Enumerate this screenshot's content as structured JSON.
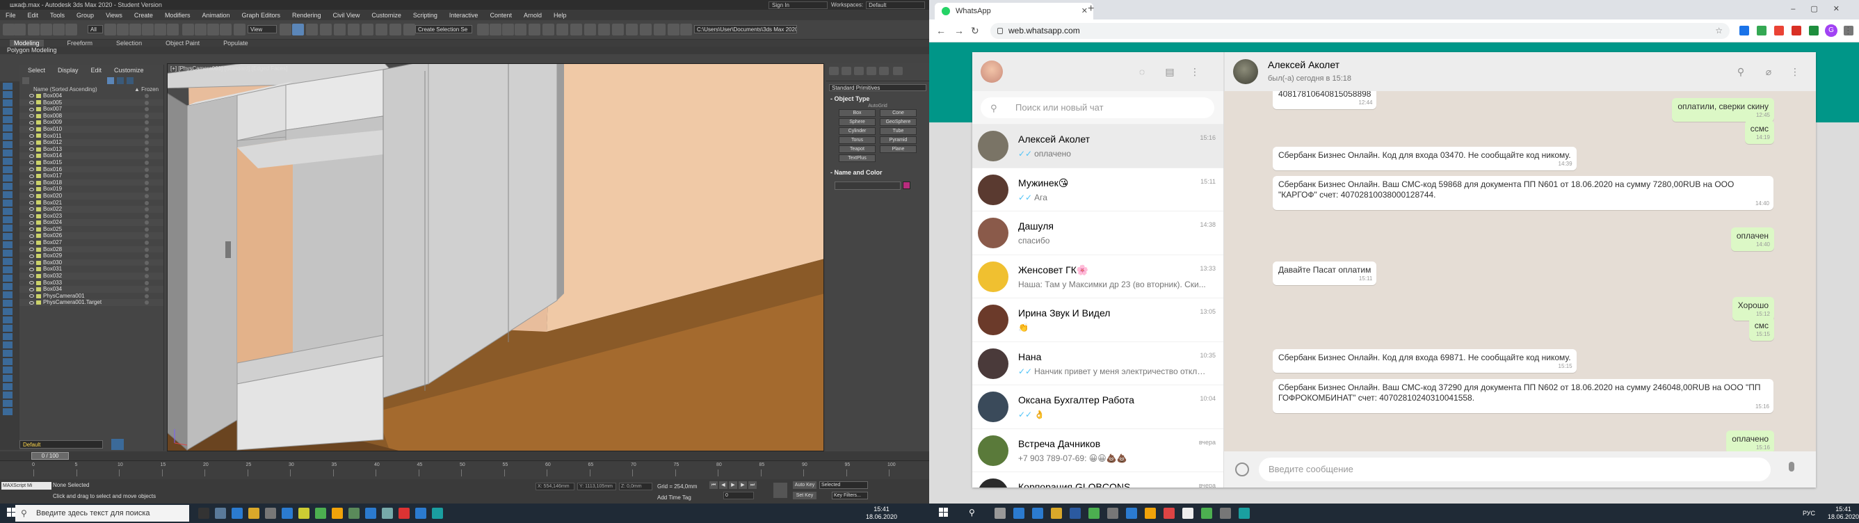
{
  "max": {
    "title": "шкаф.max - Autodesk 3ds Max 2020 - Student Version",
    "menu": [
      "File",
      "Edit",
      "Tools",
      "Group",
      "Views",
      "Create",
      "Modifiers",
      "Animation",
      "Graph Editors",
      "Rendering",
      "Civil View",
      "Customize",
      "Scripting",
      "Interactive",
      "Content",
      "Arnold",
      "Help"
    ],
    "signin": "Sign In",
    "workspaces_label": "Workspaces:",
    "workspaces_value": "Default",
    "toolbar_all": "All",
    "toolbar_view": "View",
    "toolbar_selset": "Create Selection Se",
    "toolbar_path": "C:\\Users\\User\\Documents\\3ds Max 2020",
    "ribbon_tabs": [
      "Modeling",
      "Freeform",
      "Selection",
      "Object Paint",
      "Populate"
    ],
    "polymod": "Polygon Modeling",
    "scene_tabs": [
      "Select",
      "Display",
      "Edit",
      "Customize"
    ],
    "scene_col_name": "Name (Sorted Ascending)",
    "scene_col_frozen": "▲ Frozen",
    "scene_items": [
      "Box004",
      "Box005",
      "Box007",
      "Box008",
      "Box009",
      "Box010",
      "Box011",
      "Box012",
      "Box013",
      "Box014",
      "Box015",
      "Box016",
      "Box017",
      "Box018",
      "Box019",
      "Box020",
      "Box021",
      "Box022",
      "Box023",
      "Box024",
      "Box025",
      "Box026",
      "Box027",
      "Box028",
      "Box029",
      "Box030",
      "Box031",
      "Box032",
      "Box033",
      "Box034",
      "PhysCamera001",
      "PhysCamera001.Target"
    ],
    "viewport_label": "[+] [PhysCamera001] [Standard] [Edged Faces]",
    "cmd_dropdown": "Standard Primitives",
    "rollout_object_type": "- Object Type",
    "autogrid": "AutoGrid",
    "objects": [
      "Box",
      "Cone",
      "Sphere",
      "GeoSphere",
      "Cylinder",
      "Tube",
      "Torus",
      "Pyramid",
      "Teapot",
      "Plane",
      "TextPlus"
    ],
    "rollout_name_color": "- Name and Color",
    "layer_default": "Default",
    "time_slider": "0 / 100",
    "ruler_ticks": [
      "0",
      "5",
      "10",
      "15",
      "20",
      "25",
      "30",
      "35",
      "40",
      "45",
      "50",
      "55",
      "60",
      "65",
      "70",
      "75",
      "80",
      "85",
      "90",
      "95",
      "100"
    ],
    "maxscript": "MAXScript Mi",
    "status_selected": "None Selected",
    "status_prompt": "Click and drag to select and move objects",
    "coord_x": "X: 554,146mm",
    "coord_y": "Y: 1113,105mm",
    "coord_z": "Z: 0,0mm",
    "grid_label": "Grid = 254,0mm",
    "add_time_tag": "Add Time Tag",
    "auto_key": "Auto Key",
    "set_key": "Set Key",
    "selected_dd": "Selected",
    "key_filters": "Key Filters...",
    "frame_value": "0"
  },
  "chrome": {
    "tab_title": "WhatsApp",
    "url": "web.whatsapp.com",
    "profile_letter": "G"
  },
  "whatsapp": {
    "search_placeholder": "Поиск или новый чат",
    "chats": [
      {
        "name": "Алексей Аколет",
        "time": "15:16",
        "preview": "оплачено",
        "tick": "✓✓",
        "avatar": "#7a7466"
      },
      {
        "name": "Мужинек😘",
        "time": "15:11",
        "preview": "Ага",
        "tick": "✓✓",
        "avatar": "#5a3a30"
      },
      {
        "name": "Дашуля",
        "time": "14:38",
        "preview": "спасибо",
        "tick": "",
        "avatar": "#8a5a4a"
      },
      {
        "name": "Женсовет ГК🌸",
        "time": "13:33",
        "preview": "Наша: Там у Максимки др 23 (во вторник). Ски...",
        "tick": "",
        "avatar": "#f0c030"
      },
      {
        "name": "Ирина Звук И Видел",
        "time": "13:05",
        "preview": "👏",
        "tick": "",
        "avatar": "#6b3a2a"
      },
      {
        "name": "Нана",
        "time": "10:35",
        "preview": "Нанчик привет у меня электричество отклю...",
        "tick": "✓✓",
        "avatar": "#4a3a3a"
      },
      {
        "name": "Оксана Бухгалтер Работа",
        "time": "10:04",
        "preview": "👌",
        "tick": "✓✓",
        "avatar": "#3a4a5a"
      },
      {
        "name": "Встреча Дачников",
        "time": "вчера",
        "preview": "+7 903 789-07-69: 😀😀💩💩",
        "tick": "",
        "avatar": "#5a7a3a"
      },
      {
        "name": "Корпорация GLOBCONS",
        "time": "вчера",
        "preview": "",
        "tick": "",
        "avatar": "#2a2a2a"
      }
    ],
    "contact_name": "Алексей Аколет",
    "contact_status": "был(-а) сегодня в 15:18",
    "messages": [
      {
        "dir": "in",
        "text": "40817810640815058898",
        "time": "12:44"
      },
      {
        "dir": "out",
        "text": "оплатили, сверки скину",
        "time": "12:45"
      },
      {
        "dir": "out",
        "text": "ссмс",
        "time": "14:19"
      },
      {
        "dir": "in",
        "text": "Сбербанк Бизнес Онлайн. Код для входа 03470. Не сообщайте код никому.",
        "time": "14:39"
      },
      {
        "dir": "in",
        "text": "Сбербанк Бизнес Онлайн. Ваш СМС-код 59868 для документа ПП N601 от 18.06.2020  на сумму 7280,00RUB на ООО \"КАРГОФ\" счет: 40702810038000128744.",
        "time": "14:40"
      },
      {
        "dir": "out",
        "text": "оплачен",
        "time": "14:40"
      },
      {
        "dir": "in",
        "text": "Давайте Пасат оплатим",
        "time": "15:11"
      },
      {
        "dir": "out",
        "text": "Хорошо",
        "time": "15:12"
      },
      {
        "dir": "out",
        "text": "смс",
        "time": "15:15"
      },
      {
        "dir": "in",
        "text": "Сбербанк Бизнес Онлайн. Код для входа 69871. Не сообщайте код никому.",
        "time": "15:15"
      },
      {
        "dir": "in",
        "text": "Сбербанк Бизнес Онлайн. Ваш СМС-код 37290 для документа ПП N602 от 18.06.2020  на сумму 246048,00RUB на ООО \"ПП ГОФРОКОМБИНАТ\" счет: 40702810240310041558.",
        "time": "15:16"
      },
      {
        "dir": "out",
        "text": "оплачено",
        "time": "15:16"
      }
    ],
    "composer_placeholder": "Введите сообщение"
  },
  "taskbar": {
    "search_placeholder": "Введите здесь текст для поиска",
    "left_time": "15:41",
    "left_date": "18.06.2020",
    "right_time": "15:41",
    "right_date": "18.06.2020",
    "lang": "РУС"
  }
}
